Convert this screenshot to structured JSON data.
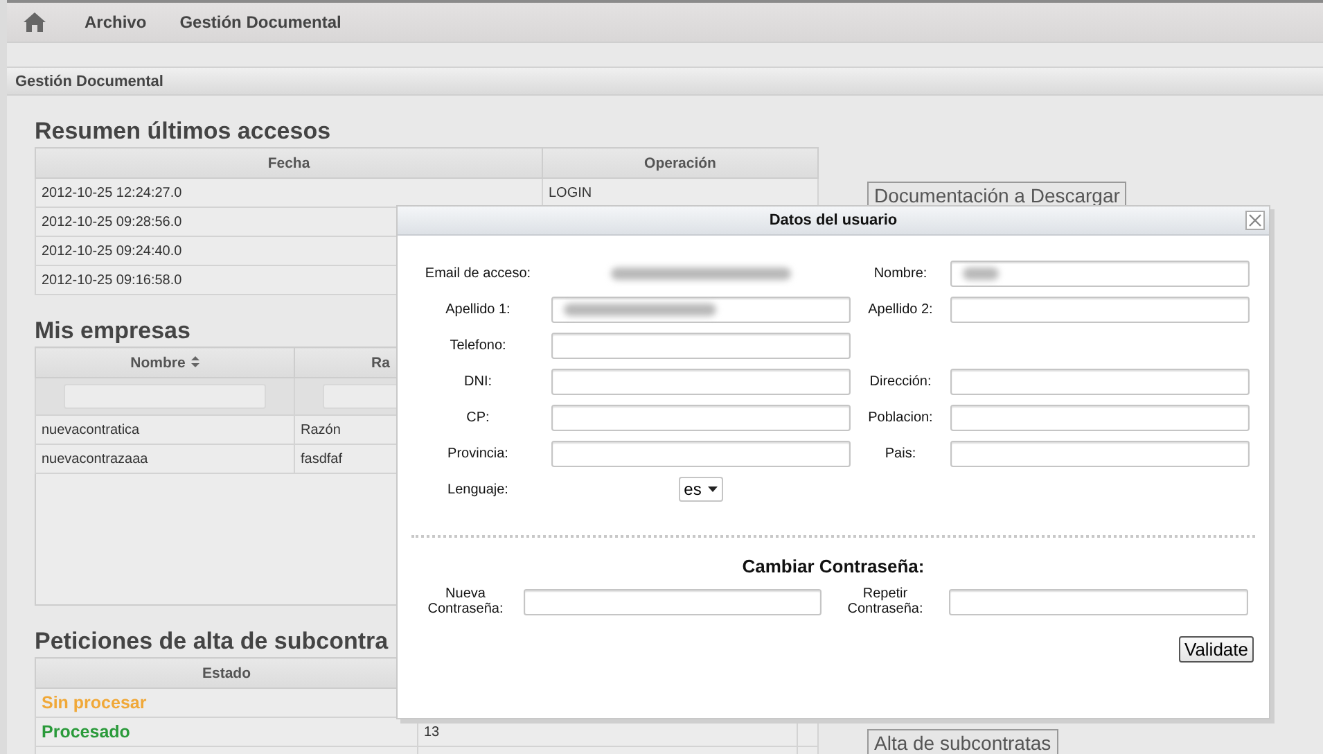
{
  "nav": {
    "items": [
      "Archivo",
      "Gestión Documental"
    ]
  },
  "panel": {
    "title": "Gestión Documental"
  },
  "accesses": {
    "title": "Resumen últimos accesos",
    "columns": [
      "Fecha",
      "Operación"
    ],
    "rows": [
      {
        "date": "2012-10-25 12:24:27.0",
        "operation": "LOGIN"
      },
      {
        "date": "2012-10-25 09:28:56.0"
      },
      {
        "date": "2012-10-25 09:24:40.0"
      },
      {
        "date": "2012-10-25 09:16:58.0"
      }
    ]
  },
  "companies": {
    "title": "Mis empresas",
    "columns": [
      {
        "label": "Nombre",
        "sortable": true
      },
      {
        "label": "Ra"
      }
    ],
    "rows": [
      [
        "nuevacontratica",
        "Razón"
      ],
      [
        "nuevacontrazaaa",
        "fasdfaf"
      ]
    ]
  },
  "requests": {
    "title": "Peticiones de alta de subcontra",
    "columns": [
      "Estado"
    ],
    "rows": [
      {
        "status": "Sin procesar",
        "color": "#f0a838"
      },
      {
        "status": "Procesado",
        "color": "#2a9a3a",
        "count": "13"
      }
    ]
  },
  "side_buttons": [
    "Documentación a Descargar",
    "Alta de subcontratas"
  ],
  "dialog": {
    "title": "Datos del usuario",
    "rows": [
      [
        {
          "label": "Email de acceso:",
          "kind": "text",
          "redacted": true
        },
        {
          "label": "Nombre:",
          "kind": "input",
          "redacted": true
        }
      ],
      [
        {
          "label": "Apellido 1:",
          "kind": "input",
          "redacted": true
        },
        {
          "label": "Apellido 2:",
          "kind": "input"
        }
      ],
      [
        {
          "label": "Telefono:",
          "kind": "input"
        }
      ],
      [
        {
          "label": "DNI:",
          "kind": "input"
        },
        {
          "label": "Dirección:",
          "kind": "input"
        }
      ],
      [
        {
          "label": "CP:",
          "kind": "input"
        },
        {
          "label": "Poblacion:",
          "kind": "input"
        }
      ],
      [
        {
          "label": "Provincia:",
          "kind": "input"
        },
        {
          "label": "Pais:",
          "kind": "input"
        }
      ],
      [
        {
          "label": "Lenguaje:",
          "kind": "select",
          "value": "es"
        }
      ]
    ],
    "password": {
      "title": "Cambiar Contraseña:",
      "fields": [
        {
          "label": "Nueva\nContraseña:"
        },
        {
          "label": "Repetir\nContraseña:"
        }
      ]
    },
    "submit": "Validate"
  }
}
